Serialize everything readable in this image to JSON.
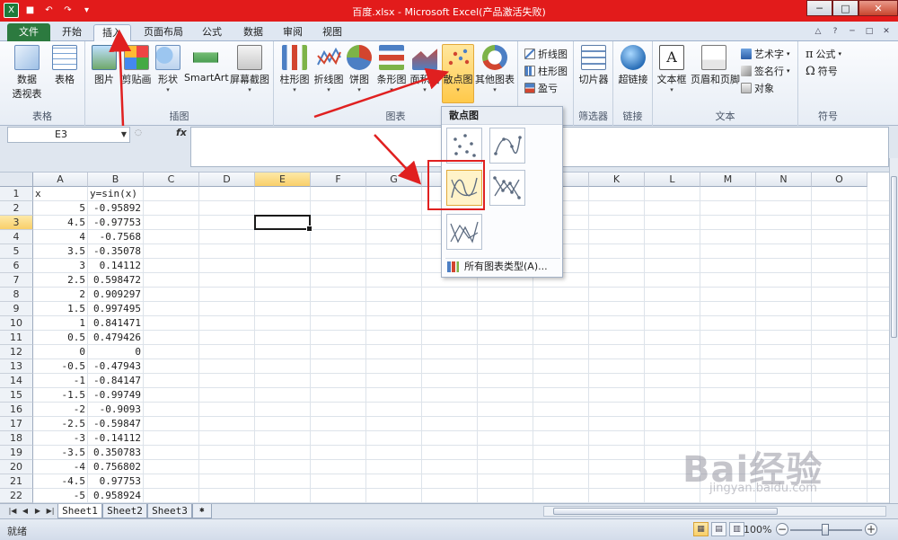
{
  "window": {
    "title": "百度.xlsx - Microsoft Excel(产品激活失败)",
    "minimize_label": "─",
    "restore_label": "□",
    "close_label": "✕"
  },
  "quick_access": {
    "excel_icon": "X",
    "save_icon": "■",
    "undo_icon": "↶",
    "redo_icon": "↷",
    "customize_icon": "▾"
  },
  "tabs": [
    {
      "label": "文件"
    },
    {
      "label": "开始"
    },
    {
      "label": "插入"
    },
    {
      "label": "页面布局"
    },
    {
      "label": "公式"
    },
    {
      "label": "数据"
    },
    {
      "label": "审阅"
    },
    {
      "label": "视图"
    }
  ],
  "tab_right_icons": [
    "△",
    "?",
    "─",
    "□",
    "✕"
  ],
  "ribbon": {
    "tables": {
      "group_label": "表格",
      "pivot_label": "数据",
      "pivot_label2": "透视表",
      "table_label": "表格"
    },
    "illustrations": {
      "group_label": "插图",
      "picture": "图片",
      "clipart": "剪贴画",
      "shapes": "形状",
      "smartart": "SmartArt",
      "screenshot": "屏幕截图"
    },
    "charts": {
      "group_label": "图表",
      "column": "柱形图",
      "line": "折线图",
      "pie": "饼图",
      "bar": "条形图",
      "area": "面积图",
      "scatter": "散点图",
      "other": "其他图表"
    },
    "sparklines": {
      "group_label": "迷你图",
      "line": "折线图",
      "column": "柱形图",
      "winloss": "盈亏"
    },
    "filter": {
      "group_label": "筛选器",
      "slicer": "切片器"
    },
    "links": {
      "group_label": "链接",
      "hyperlink": "超链接"
    },
    "text": {
      "group_label": "文本",
      "textbox": "文本框",
      "header_footer": "页眉和页脚",
      "wordart": "艺术字",
      "signature": "签名行",
      "object": "对象"
    },
    "symbols": {
      "group_label": "符号",
      "equation": "公式",
      "symbol": "符号"
    }
  },
  "formula_bar": {
    "name_box": "E3",
    "fx_label": "fx",
    "formula": ""
  },
  "columns": [
    "A",
    "B",
    "C",
    "D",
    "E",
    "F",
    "G",
    "H",
    "I",
    "J",
    "K",
    "L",
    "M",
    "N",
    "O"
  ],
  "selected_column": "E",
  "selected_row": "3",
  "rows": [
    {
      "num": "1",
      "a": "x",
      "b": "y=sin(x)"
    },
    {
      "num": "2",
      "a": "5",
      "b": "-0.95892"
    },
    {
      "num": "3",
      "a": "4.5",
      "b": "-0.97753"
    },
    {
      "num": "4",
      "a": "4",
      "b": "-0.7568"
    },
    {
      "num": "5",
      "a": "3.5",
      "b": "-0.35078"
    },
    {
      "num": "6",
      "a": "3",
      "b": "0.14112"
    },
    {
      "num": "7",
      "a": "2.5",
      "b": "0.598472"
    },
    {
      "num": "8",
      "a": "2",
      "b": "0.909297"
    },
    {
      "num": "9",
      "a": "1.5",
      "b": "0.997495"
    },
    {
      "num": "10",
      "a": "1",
      "b": "0.841471"
    },
    {
      "num": "11",
      "a": "0.5",
      "b": "0.479426"
    },
    {
      "num": "12",
      "a": "0",
      "b": "0"
    },
    {
      "num": "13",
      "a": "-0.5",
      "b": "-0.47943"
    },
    {
      "num": "14",
      "a": "-1",
      "b": "-0.84147"
    },
    {
      "num": "15",
      "a": "-1.5",
      "b": "-0.99749"
    },
    {
      "num": "16",
      "a": "-2",
      "b": "-0.9093"
    },
    {
      "num": "17",
      "a": "-2.5",
      "b": "-0.59847"
    },
    {
      "num": "18",
      "a": "-3",
      "b": "-0.14112"
    },
    {
      "num": "19",
      "a": "-3.5",
      "b": "0.350783"
    },
    {
      "num": "20",
      "a": "-4",
      "b": "0.756802"
    },
    {
      "num": "21",
      "a": "-4.5",
      "b": "0.97753"
    },
    {
      "num": "22",
      "a": "-5",
      "b": "0.958924"
    },
    {
      "num": "23",
      "a": "",
      "b": ""
    }
  ],
  "scatter_dropdown": {
    "title": "散点图",
    "all_chart_types": "所有图表类型(A)..."
  },
  "sheets": [
    {
      "label": "Sheet1"
    },
    {
      "label": "Sheet2"
    },
    {
      "label": "Sheet3"
    }
  ],
  "status": {
    "ready": "就绪",
    "zoom": "100%",
    "zoom_minus": "−",
    "zoom_plus": "+"
  },
  "watermark": {
    "brand": "Bai经验",
    "url": "jingyan.baidu.com"
  },
  "colors": {
    "title_bar": "#e21b1b",
    "file_tab": "#2c7a3f",
    "selection": "#f9cf69",
    "annotation_red": "#e02020"
  }
}
